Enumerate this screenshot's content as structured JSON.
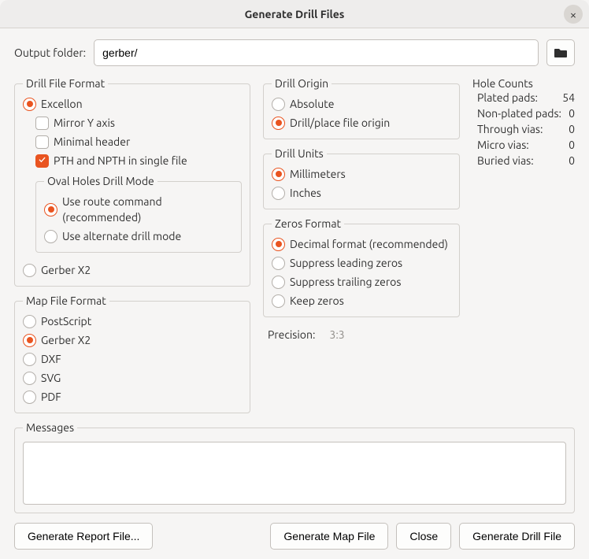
{
  "window": {
    "title": "Generate Drill Files",
    "close_icon": "×"
  },
  "output": {
    "label": "Output folder:",
    "value": "gerber/"
  },
  "drill_format": {
    "legend": "Drill File Format",
    "excellon": "Excellon",
    "mirror_y": "Mirror Y axis",
    "minimal_header": "Minimal header",
    "pth_npth": "PTH and NPTH in single file",
    "oval_legend": "Oval Holes Drill Mode",
    "route_cmd": "Use route command (recommended)",
    "alt_mode": "Use alternate drill mode",
    "gerber_x2": "Gerber X2",
    "selected": "excellon",
    "mirror_y_checked": false,
    "minimal_header_checked": false,
    "pth_npth_checked": true,
    "oval_selected": "route"
  },
  "map_format": {
    "legend": "Map File Format",
    "options": [
      "PostScript",
      "Gerber X2",
      "DXF",
      "SVG",
      "PDF"
    ],
    "selected_index": 1
  },
  "drill_origin": {
    "legend": "Drill Origin",
    "absolute": "Absolute",
    "place_origin": "Drill/place file origin",
    "selected": "place"
  },
  "drill_units": {
    "legend": "Drill Units",
    "mm": "Millimeters",
    "in": "Inches",
    "selected": "mm"
  },
  "zeros": {
    "legend": "Zeros Format",
    "decimal": "Decimal format (recommended)",
    "sup_leading": "Suppress leading zeros",
    "sup_trailing": "Suppress trailing zeros",
    "keep": "Keep zeros",
    "selected": "decimal"
  },
  "precision": {
    "label": "Precision:",
    "value": "3:3"
  },
  "hole_counts": {
    "legend": "Hole Counts",
    "rows": [
      {
        "label": "Plated pads:",
        "value": "54"
      },
      {
        "label": "Non-plated pads:",
        "value": "0"
      },
      {
        "label": "Through vias:",
        "value": "0"
      },
      {
        "label": "Micro vias:",
        "value": "0"
      },
      {
        "label": "Buried vias:",
        "value": "0"
      }
    ]
  },
  "messages": {
    "legend": "Messages"
  },
  "buttons": {
    "report": "Generate Report File...",
    "map": "Generate Map File",
    "close": "Close",
    "drill": "Generate Drill File"
  }
}
